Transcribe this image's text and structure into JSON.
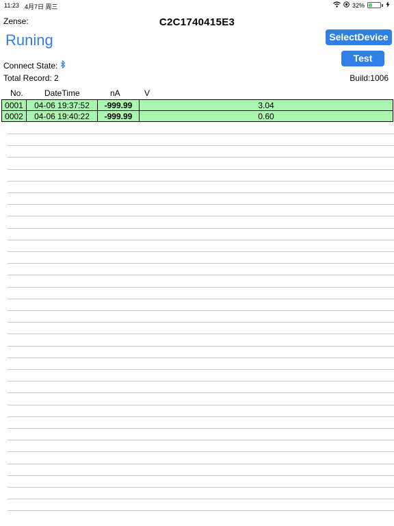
{
  "status_bar": {
    "time": "11:23",
    "date": "4月7日 周三",
    "battery_percent": "32%",
    "battery_level": 0.32,
    "icons": [
      "wifi-icon",
      "location-icon",
      "battery-icon",
      "charging-icon"
    ]
  },
  "header": {
    "zense_label": "Zense:",
    "device_id": "C2C1740415E3",
    "run_status": "Runing",
    "select_device_label": "SelectDevice",
    "test_label": "Test"
  },
  "info": {
    "connect_state_label": "Connect State:",
    "connect_icon": "bluetooth-icon",
    "total_record": "Total Record: 2",
    "build": "Build:1006"
  },
  "table": {
    "headers": [
      "No.",
      "DateTime",
      "nA",
      "V"
    ],
    "rows": [
      {
        "no": "0001",
        "datetime": "04-06 19:37:52",
        "na": "-999.99",
        "v": "3.04"
      },
      {
        "no": "0002",
        "datetime": "04-06 19:40:22",
        "na": "-999.99",
        "v": "0.60"
      }
    ]
  },
  "colors": {
    "accent": "#2f7fe8",
    "row_background": "#a9f7ae",
    "line": "#c8c8c8"
  }
}
